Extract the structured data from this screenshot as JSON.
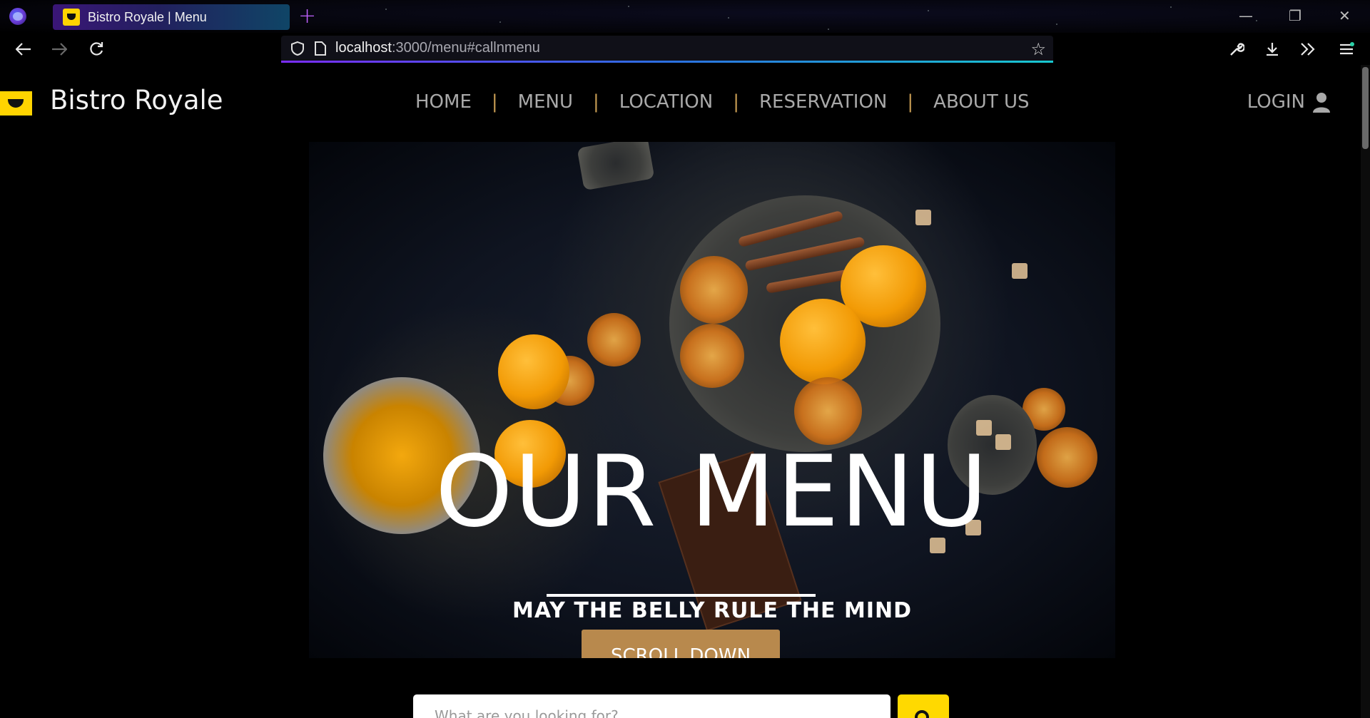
{
  "browser": {
    "tab_title": "Bistro Royale | Menu",
    "new_tab_label": "+",
    "url_host": "localhost",
    "url_path": ":3000/menu#callnmenu",
    "window_controls": [
      "—",
      "❐",
      "✕"
    ]
  },
  "site": {
    "name": "Bistro Royale",
    "nav": [
      {
        "label": "HOME"
      },
      {
        "label": "MENU"
      },
      {
        "label": "LOCATION"
      },
      {
        "label": "RESERVATION"
      },
      {
        "label": "ABOUT US"
      }
    ],
    "separator": "|",
    "login_label": "LOGIN",
    "accent_color": "#c49a52",
    "logo_color": "#ffd400"
  },
  "hero": {
    "title": "OUR MENU",
    "subtitle": "MAY THE BELLY RULE THE MIND",
    "button_label": "SCROLL DOWN",
    "button_color": "#b8894d"
  },
  "search": {
    "placeholder": "What are you looking for?",
    "button_color": "#ffd900",
    "icon": "search-icon"
  }
}
